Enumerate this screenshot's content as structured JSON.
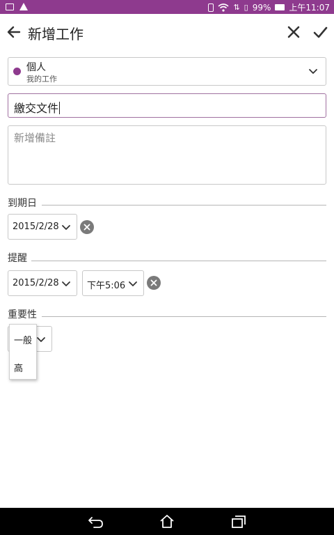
{
  "status_bar": {
    "battery": "99%",
    "time": "上午11:07",
    "background": "#8e3a8e"
  },
  "app_bar": {
    "title": "新增工作",
    "back_icon": "arrow-left-icon",
    "cancel_icon": "close-icon",
    "save_icon": "check-icon"
  },
  "notebook": {
    "name": "個人",
    "section": "我的工作",
    "color": "#8e3a8e"
  },
  "task": {
    "title_value": "繳交文件",
    "notes_placeholder": "新增備註"
  },
  "due_date": {
    "label": "到期日",
    "date": "2015/2/28"
  },
  "reminder": {
    "label": "提醒",
    "date": "2015/2/28",
    "time": "下午5:06"
  },
  "priority": {
    "label": "重要性",
    "options": [
      "一般",
      "高"
    ]
  },
  "nav_bar": {
    "back_icon": "nav-back-icon",
    "home_icon": "nav-home-icon",
    "recents_icon": "nav-recents-icon"
  }
}
